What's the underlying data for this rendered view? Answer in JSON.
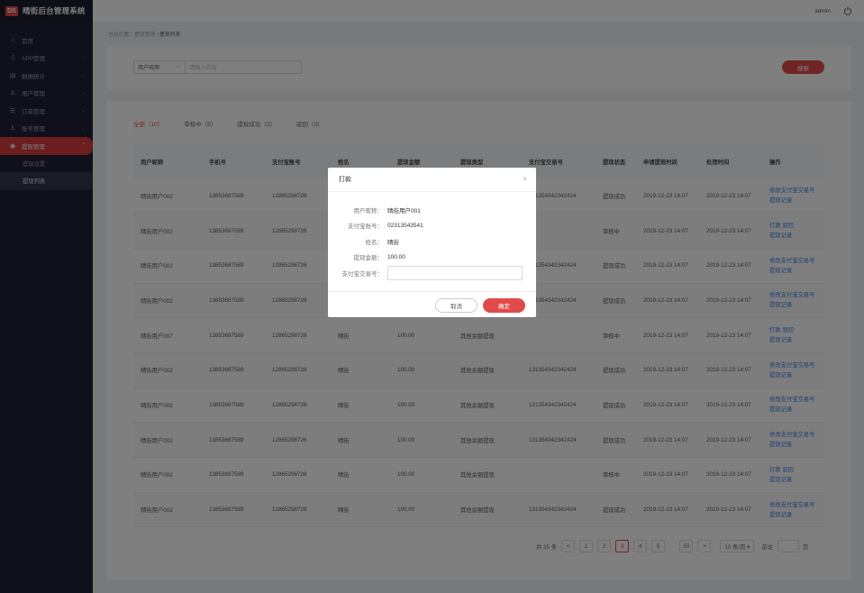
{
  "app": {
    "logo_mark": "DS",
    "title": "晴街后台管理系统"
  },
  "header": {
    "user": "admin"
  },
  "sidebar": {
    "items": [
      {
        "label": "首页",
        "icon": "home-icon",
        "glyph": "⌂"
      },
      {
        "label": "APP管理",
        "icon": "app-icon",
        "glyph": "▯"
      },
      {
        "label": "数据统计",
        "icon": "stats-icon",
        "glyph": "▤"
      },
      {
        "label": "用户管理",
        "icon": "user-icon",
        "glyph": "♙"
      },
      {
        "label": "订单管理",
        "icon": "order-icon",
        "glyph": "☰"
      },
      {
        "label": "账号管理",
        "icon": "account-icon",
        "glyph": "♙"
      },
      {
        "label": "提现管理",
        "icon": "withdraw-icon",
        "glyph": "◉"
      }
    ],
    "sub_items": [
      {
        "label": "提现设置"
      },
      {
        "label": "提现列表"
      }
    ]
  },
  "breadcrumb": {
    "prefix": "当前位置：提现管理 /",
    "current": "提现列表"
  },
  "search": {
    "select_value": "用户昵称",
    "placeholder": "请输入内容",
    "button": "搜索"
  },
  "tabs": [
    {
      "label": "全部（10）"
    },
    {
      "label": "审核中（5）"
    },
    {
      "label": "提现成功（2）"
    },
    {
      "label": "驳回（3）"
    }
  ],
  "table": {
    "columns": [
      "用户昵称",
      "手机号",
      "支付宝账号",
      "姓名",
      "提现金额",
      "提现类型",
      "支付宝交易号",
      "提现状态",
      "申请提现时间",
      "处理时间",
      "操作"
    ],
    "rows": [
      {
        "nick": "晴街用户002",
        "phone": "13853687589",
        "alipay": "12865298726",
        "name": "",
        "amount": "",
        "type": "",
        "trade_no": "131354342342424",
        "status": "提现成功",
        "apply_time": "2019-12-23 14:07",
        "handle_time": "2019-12-23 14:07",
        "actions": [
          "修改支付宝交易号",
          "提现记录"
        ]
      },
      {
        "nick": "晴街用户002",
        "phone": "13853687589",
        "alipay": "12865298726",
        "name": "",
        "amount": "",
        "type": "",
        "trade_no": "",
        "status": "审核中",
        "apply_time": "2019-12-23 14:07",
        "handle_time": "2019-12-23 14:07",
        "actions": [
          "打款  驳回",
          "提现记录"
        ]
      },
      {
        "nick": "晴街用户002",
        "phone": "13853687589",
        "alipay": "12865298726",
        "name": "",
        "amount": "",
        "type": "",
        "trade_no": "131354342342424",
        "status": "提现成功",
        "apply_time": "2019-12-23 14:07",
        "handle_time": "2019-12-23 14:07",
        "actions": [
          "修改支付宝交易号",
          "提现记录"
        ]
      },
      {
        "nick": "晴街用户002",
        "phone": "13853687589",
        "alipay": "12865298726",
        "name": "",
        "amount": "",
        "type": "",
        "trade_no": "131354342342424",
        "status": "提现成功",
        "apply_time": "2019-12-23 14:07",
        "handle_time": "2019-12-23 14:07",
        "actions": [
          "修改支付宝交易号",
          "提现记录"
        ]
      },
      {
        "nick": "晴街用户007",
        "phone": "13853687589",
        "alipay": "12865298726",
        "name": "晴街",
        "amount": "100.00",
        "type": "其他余额提现",
        "trade_no": "",
        "status": "审核中",
        "apply_time": "2019-12-23 14:07",
        "handle_time": "2019-12-23 14:07",
        "actions": [
          "打款  驳回",
          "提现记录"
        ]
      },
      {
        "nick": "晴街用户002",
        "phone": "13853687589",
        "alipay": "12865298726",
        "name": "晴街",
        "amount": "100.00",
        "type": "其他余额提现",
        "trade_no": "131354342342424",
        "status": "提现成功",
        "apply_time": "2019-12-23 14:07",
        "handle_time": "2019-12-23 14:07",
        "actions": [
          "修改支付宝交易号",
          "提现记录"
        ]
      },
      {
        "nick": "晴街用户002",
        "phone": "13853687589",
        "alipay": "12865298726",
        "name": "晴街",
        "amount": "100.00",
        "type": "其他余额提现",
        "trade_no": "131354342342424",
        "status": "提现成功",
        "apply_time": "2019-12-23 14:07",
        "handle_time": "2019-12-23 14:07",
        "actions": [
          "修改支付宝交易号",
          "提现记录"
        ]
      },
      {
        "nick": "晴街用户002",
        "phone": "13853687589",
        "alipay": "12865298726",
        "name": "晴街",
        "amount": "100.00",
        "type": "其他余额提现",
        "trade_no": "131354342342424",
        "status": "提现成功",
        "apply_time": "2019-12-23 14:07",
        "handle_time": "2019-12-23 14:07",
        "actions": [
          "修改支付宝交易号",
          "提现记录"
        ]
      },
      {
        "nick": "晴街用户002",
        "phone": "13853687589",
        "alipay": "12865298726",
        "name": "晴街",
        "amount": "100.00",
        "type": "其他余额提现",
        "trade_no": "",
        "status": "审核中",
        "apply_time": "2019-12-23 14:07",
        "handle_time": "2019-12-23 14:07",
        "actions": [
          "打款  驳回",
          "提现记录"
        ]
      },
      {
        "nick": "晴街用户002",
        "phone": "13853687589",
        "alipay": "12865298726",
        "name": "晴街",
        "amount": "100.00",
        "type": "其他余额提现",
        "trade_no": "131354342342424",
        "status": "提现成功",
        "apply_time": "2019-12-23 14:07",
        "handle_time": "2019-12-23 14:07",
        "actions": [
          "修改支付宝交易号",
          "提现记录"
        ]
      }
    ]
  },
  "pagination": {
    "total": "共 35 条",
    "prev": "<",
    "pages": [
      "1",
      "2",
      "3",
      "4",
      "5"
    ],
    "current_page": "3",
    "dots": "···",
    "last": "50",
    "next": ">",
    "page_size": "10 条/页 ▾",
    "goto": "前往",
    "unit": "页"
  },
  "modal": {
    "title": "打款",
    "close": "×",
    "fields": [
      {
        "label": "用户昵称：",
        "value": "晴街用户001"
      },
      {
        "label": "支付宝账号：",
        "value": "02313543541"
      },
      {
        "label": "姓名：",
        "value": "晴街"
      },
      {
        "label": "提现金额：",
        "value": "100.00"
      }
    ],
    "input_label": "支付宝交易号：",
    "cancel": "取消",
    "ok": "确定"
  },
  "colors": {
    "accent": "#e14a4a",
    "sidebar": "#1f2133",
    "link": "#3b7de0"
  }
}
